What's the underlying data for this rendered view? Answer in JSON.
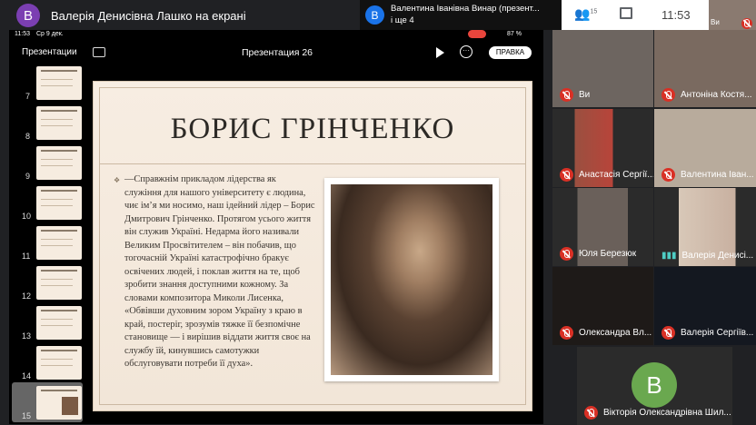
{
  "meet": {
    "presenter_avatar_letter": "В",
    "presenter_banner": "Валерія Денисівна Лашко на екрані",
    "other_presenter_avatar_letter": "В",
    "other_presenter": "Валентина Іванівна Винар (презент...",
    "other_presenter_more": "і ще 4",
    "participants_count": "15",
    "clock": "11:53",
    "self_label": "Ви",
    "colors": {
      "purple_avatar": "#7b3fb2",
      "blue_avatar": "#1a73e8",
      "green_avatar": "#6aa84f",
      "mute_red": "#d93025"
    }
  },
  "ipad": {
    "status_time": "11:53",
    "status_date": "Ср 9 дек.",
    "battery": "87 %",
    "toolbar_left": "Презентации",
    "doc_title": "Презентация 26",
    "edit_button": "ПРАВКА",
    "thumbnails": [
      {
        "num": "7"
      },
      {
        "num": "8"
      },
      {
        "num": "9"
      },
      {
        "num": "10"
      },
      {
        "num": "11"
      },
      {
        "num": "12"
      },
      {
        "num": "13"
      },
      {
        "num": "14"
      },
      {
        "num": "15",
        "selected": true
      }
    ]
  },
  "slide": {
    "title": "БОРИС ГРІНЧЕНКО",
    "body": "—Справжнім прикладом лідерства як служіння для нашого університету є людина, чиє ім’я ми носимо, наш ідейний лідер – Борис Дмитрович Грінченко. Протягом усього життя він служив Україні. Недарма його називали Великим Просвітителем – він побачив, що тогочасній Україні катастрофічно бракує освічених людей, і поклав життя на те, щоб зробити знання доступними кожному. За словами композитора Миколи Лисенка, «Обвівши духовним зором Україну з краю в край, постеріг, зрозумів тяжке її безпомічне становище — і вирішив віддати життя своє на службу їй, кинувшись самотужки обслуговувати потреби її духа»."
  },
  "participants": [
    {
      "name": "Ви",
      "muted": true
    },
    {
      "name": "Антоніна Костя...",
      "muted": true
    },
    {
      "name": "Анастасія Сергії...",
      "muted": true
    },
    {
      "name": "Валентина Іван...",
      "muted": true
    },
    {
      "name": "Юля Березюк",
      "muted": true
    },
    {
      "name": "Валерія Денисі...",
      "muted": false
    },
    {
      "name": "Олександра Вл...",
      "muted": true
    },
    {
      "name": "Валерія Сергіїв...",
      "muted": true
    },
    {
      "name": "Вікторія Олександрівна Шил...",
      "muted": true,
      "avatar_letter": "В"
    }
  ]
}
